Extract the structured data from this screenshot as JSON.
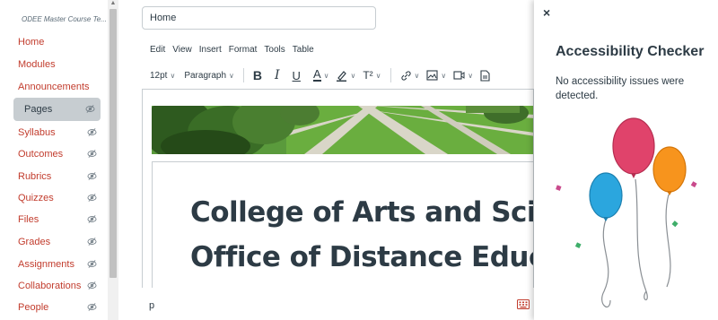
{
  "course_nav": {
    "title": "ODEE Master Course Te...",
    "items": [
      {
        "label": "Home",
        "hidden": false
      },
      {
        "label": "Modules",
        "hidden": false
      },
      {
        "label": "Announcements",
        "hidden": false
      },
      {
        "label": "Pages",
        "hidden": true,
        "active": true
      },
      {
        "label": "Syllabus",
        "hidden": true
      },
      {
        "label": "Outcomes",
        "hidden": true
      },
      {
        "label": "Rubrics",
        "hidden": true
      },
      {
        "label": "Quizzes",
        "hidden": true
      },
      {
        "label": "Files",
        "hidden": true
      },
      {
        "label": "Grades",
        "hidden": true
      },
      {
        "label": "Assignments",
        "hidden": true
      },
      {
        "label": "Collaborations",
        "hidden": true
      },
      {
        "label": "People",
        "hidden": true
      }
    ]
  },
  "editor": {
    "page_title_value": "Home",
    "menus": [
      "Edit",
      "View",
      "Insert",
      "Format",
      "Tools",
      "Table"
    ],
    "font_size": "12pt",
    "block_format": "Paragraph",
    "heading_line_1": "College of Arts and Scienc",
    "heading_line_2": "Office of Distance Educati",
    "path": "p"
  },
  "a11y_panel": {
    "close_label": "×",
    "title": "Accessibility Checker",
    "message": "No accessibility issues were detected."
  },
  "colors": {
    "nav_link": "#c23c2d",
    "active_bg": "#c7cdd1",
    "balloon_pink": "#e0436b",
    "balloon_orange": "#f7941d",
    "balloon_blue": "#2ba6de"
  }
}
